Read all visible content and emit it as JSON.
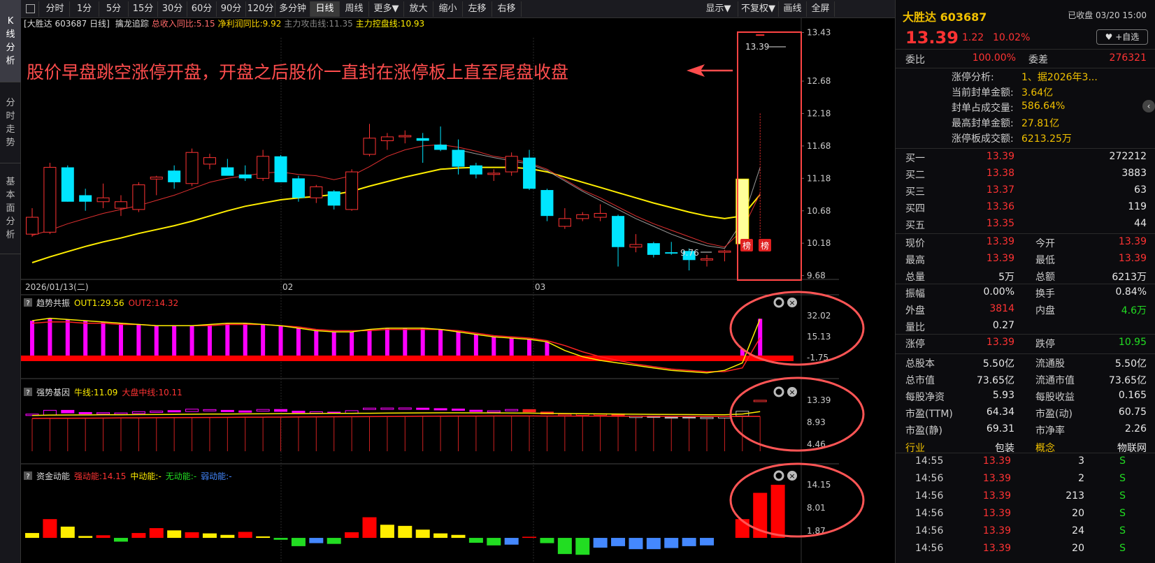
{
  "left_tabs": [
    {
      "label": "K线分析",
      "active": true
    },
    {
      "label": "分时走势",
      "active": false
    },
    {
      "label": "基本面分析",
      "active": false
    }
  ],
  "toolbar": {
    "left": [
      "分时",
      "1分",
      "5分",
      "15分",
      "30分",
      "60分",
      "90分",
      "120分",
      "多分钟",
      "日线",
      "周线",
      "更多▼",
      "放大",
      "缩小",
      "左移",
      "右移"
    ],
    "active": "日线",
    "right": [
      "显示▼",
      "不复权▼",
      "画线",
      "全屏"
    ]
  },
  "main_panel": {
    "stock_label": "[大胜达 603687 日线]",
    "indicator_name": "擒龙追踪",
    "items": [
      {
        "text": "总收入同比:5.15",
        "color": "#ff6a6a"
      },
      {
        "text": "净利润同比:9.92",
        "color": "#ffd700"
      },
      {
        "text": "主力攻击线:11.35",
        "color": "#888888"
      },
      {
        "text": "主力控盘线:10.93",
        "color": "#ffee00"
      }
    ],
    "yticks": [
      "13.43",
      "12.68",
      "12.18",
      "11.68",
      "11.18",
      "10.68",
      "10.18",
      "9.68"
    ],
    "date_labels": [
      "2026/01/13(二)",
      "02",
      "03"
    ],
    "annotation": "股价早盘跳空涨停开盘，开盘之后股价一直封在涨停板上直至尾盘收盘",
    "price_high_label": "13.39",
    "price_low_label": "9.76",
    "badge": "榜"
  },
  "sub1": {
    "title": "趋势共振",
    "items": [
      {
        "text": "OUT1:29.56",
        "color": "#ffee00"
      },
      {
        "text": "OUT2:14.32",
        "color": "#ff3333"
      }
    ],
    "yticks": [
      "32.02",
      "15.13",
      "-1.75"
    ]
  },
  "sub2": {
    "title": "强势基因",
    "items": [
      {
        "text": "牛线:11.09",
        "color": "#ffee00"
      },
      {
        "text": "大盘中线:10.11",
        "color": "#ff3333"
      }
    ],
    "yticks": [
      "13.39",
      "8.93",
      "4.46"
    ]
  },
  "sub3": {
    "title": "资金动能",
    "items": [
      {
        "text": "强动能:14.15",
        "color": "#ff3333"
      },
      {
        "text": "中动能:-",
        "color": "#ffee00"
      },
      {
        "text": "无动能:-",
        "color": "#22dd22"
      },
      {
        "text": "弱动能:-",
        "color": "#4488ff"
      }
    ],
    "yticks": [
      "14.15",
      "8.01",
      "1.87"
    ]
  },
  "right_panel": {
    "title": "大胜达 603687",
    "status": "已收盘 03/20 15:00",
    "price": "13.39",
    "change": "1.22",
    "change_pct": "10.02%",
    "fav": "♥ +自选",
    "webi_label": "委比",
    "webi": "100.00%",
    "weicha_label": "委差",
    "weicha": "276321",
    "limit_analysis": [
      {
        "label": "涨停分析:",
        "value": "1、据2026年3..."
      },
      {
        "label": "当前封单金额:",
        "value": "3.64亿"
      },
      {
        "label": "封单占成交量:",
        "value": "586.64%"
      },
      {
        "label": "最高封单金额:",
        "value": "27.81亿"
      },
      {
        "label": "涨停板成交额:",
        "value": "6213.25万"
      }
    ],
    "bids": [
      {
        "label": "买一",
        "price": "13.39",
        "vol": "272212"
      },
      {
        "label": "买二",
        "price": "13.38",
        "vol": "3883"
      },
      {
        "label": "买三",
        "price": "13.37",
        "vol": "63"
      },
      {
        "label": "买四",
        "price": "13.36",
        "vol": "119"
      },
      {
        "label": "买五",
        "price": "13.35",
        "vol": "44"
      }
    ],
    "quote_rows": [
      {
        "l1": "现价",
        "v1": "13.39",
        "c1": "red",
        "l2": "今开",
        "v2": "13.39",
        "c2": "red"
      },
      {
        "l1": "最高",
        "v1": "13.39",
        "c1": "red",
        "l2": "最低",
        "v2": "13.39",
        "c2": "red"
      },
      {
        "l1": "总量",
        "v1": "5万",
        "c1": "white",
        "l2": "总额",
        "v2": "6213万",
        "c2": "white"
      }
    ],
    "stat_rows": [
      {
        "l1": "振幅",
        "v1": "0.00%",
        "c1": "white",
        "l2": "换手",
        "v2": "0.84%",
        "c2": "white"
      },
      {
        "l1": "外盘",
        "v1": "3814",
        "c1": "red",
        "l2": "内盘",
        "v2": "4.6万",
        "c2": "green"
      },
      {
        "l1": "量比",
        "v1": "0.27",
        "c1": "white",
        "l2": "",
        "v2": "",
        "c2": "white"
      }
    ],
    "limit_rows": [
      {
        "l1": "涨停",
        "v1": "13.39",
        "c1": "red",
        "l2": "跌停",
        "v2": "10.95",
        "c2": "green"
      }
    ],
    "fin_rows": [
      {
        "l1": "总股本",
        "v1": "5.50亿",
        "c1": "white",
        "l2": "流通股",
        "v2": "5.50亿",
        "c2": "white"
      },
      {
        "l1": "总市值",
        "v1": "73.65亿",
        "c1": "white",
        "l2": "流通市值",
        "v2": "73.65亿",
        "c2": "white"
      },
      {
        "l1": "每股净资",
        "v1": "5.93",
        "c1": "white",
        "l2": "每股收益",
        "v2": "0.165",
        "c2": "white"
      },
      {
        "l1": "市盈(TTM)",
        "v1": "64.34",
        "c1": "white",
        "l2": "市盈(动)",
        "v2": "60.75",
        "c2": "white"
      },
      {
        "l1": "市盈(静)",
        "v1": "69.31",
        "c1": "white",
        "l2": "市净率",
        "v2": "2.26",
        "c2": "white"
      }
    ],
    "industry": {
      "label": "行业",
      "value": "包装",
      "label2": "概念",
      "value2": "物联网"
    },
    "ticks": [
      {
        "time": "14:55",
        "price": "13.39",
        "vol": "3",
        "bs": "S"
      },
      {
        "time": "14:56",
        "price": "13.39",
        "vol": "2",
        "bs": "S"
      },
      {
        "time": "14:56",
        "price": "13.39",
        "vol": "213",
        "bs": "S"
      },
      {
        "time": "14:56",
        "price": "13.39",
        "vol": "20",
        "bs": "S"
      },
      {
        "time": "14:56",
        "price": "13.39",
        "vol": "24",
        "bs": "S"
      },
      {
        "time": "14:56",
        "price": "13.39",
        "vol": "20",
        "bs": "S"
      }
    ]
  },
  "chart_data": {
    "type": "candlestick",
    "candles": [
      {
        "o": 10.32,
        "h": 10.72,
        "l": 10.28,
        "c": 10.58
      },
      {
        "o": 10.35,
        "h": 11.42,
        "l": 10.32,
        "c": 11.35
      },
      {
        "o": 11.35,
        "h": 11.38,
        "l": 10.82,
        "c": 10.82
      },
      {
        "o": 10.92,
        "h": 11.02,
        "l": 10.68,
        "c": 10.82
      },
      {
        "o": 10.82,
        "h": 11.1,
        "l": 10.72,
        "c": 10.88
      },
      {
        "o": 10.72,
        "h": 10.92,
        "l": 10.6,
        "c": 10.82
      },
      {
        "o": 10.7,
        "h": 11.12,
        "l": 10.66,
        "c": 11.08
      },
      {
        "o": 11.17,
        "h": 11.22,
        "l": 10.92,
        "c": 11.2
      },
      {
        "o": 11.3,
        "h": 11.38,
        "l": 11.02,
        "c": 11.12
      },
      {
        "o": 11.1,
        "h": 11.64,
        "l": 11.06,
        "c": 11.58
      },
      {
        "o": 11.4,
        "h": 11.56,
        "l": 11.32,
        "c": 11.5
      },
      {
        "o": 11.35,
        "h": 11.48,
        "l": 11.24,
        "c": 11.22
      },
      {
        "o": 11.24,
        "h": 11.38,
        "l": 11.14,
        "c": 11.18
      },
      {
        "o": 11.18,
        "h": 11.62,
        "l": 11.14,
        "c": 11.52
      },
      {
        "o": 11.52,
        "h": 11.54,
        "l": 11.12,
        "c": 11.12
      },
      {
        "o": 11.18,
        "h": 11.22,
        "l": 10.82,
        "c": 10.88
      },
      {
        "o": 10.88,
        "h": 11.08,
        "l": 10.8,
        "c": 11.05
      },
      {
        "o": 10.98,
        "h": 11.0,
        "l": 10.7,
        "c": 10.76
      },
      {
        "o": 10.7,
        "h": 11.32,
        "l": 10.68,
        "c": 11.28
      },
      {
        "o": 11.55,
        "h": 12.02,
        "l": 11.52,
        "c": 11.8
      },
      {
        "o": 11.76,
        "h": 11.88,
        "l": 11.62,
        "c": 11.82
      },
      {
        "o": 11.82,
        "h": 11.92,
        "l": 11.72,
        "c": 11.84
      },
      {
        "o": 11.8,
        "h": 11.88,
        "l": 11.42,
        "c": 11.76
      },
      {
        "o": 11.7,
        "h": 11.98,
        "l": 11.6,
        "c": 11.62
      },
      {
        "o": 11.62,
        "h": 11.78,
        "l": 11.24,
        "c": 11.36
      },
      {
        "o": 11.38,
        "h": 11.42,
        "l": 11.18,
        "c": 11.24
      },
      {
        "o": 11.24,
        "h": 11.32,
        "l": 11.14,
        "c": 11.26
      },
      {
        "o": 11.28,
        "h": 11.58,
        "l": 11.22,
        "c": 11.52
      },
      {
        "o": 11.5,
        "h": 11.62,
        "l": 11.0,
        "c": 11.02
      },
      {
        "o": 11.0,
        "h": 11.02,
        "l": 10.52,
        "c": 10.6
      },
      {
        "o": 10.44,
        "h": 10.72,
        "l": 10.4,
        "c": 10.56
      },
      {
        "o": 10.56,
        "h": 10.66,
        "l": 10.52,
        "c": 10.62
      },
      {
        "o": 10.58,
        "h": 10.78,
        "l": 10.52,
        "c": 10.64
      },
      {
        "o": 10.6,
        "h": 10.62,
        "l": 9.82,
        "c": 10.12
      },
      {
        "o": 10.12,
        "h": 10.32,
        "l": 10.04,
        "c": 10.16
      },
      {
        "o": 10.18,
        "h": 10.2,
        "l": 9.96,
        "c": 10.0
      },
      {
        "o": 10.04,
        "h": 10.2,
        "l": 10.0,
        "c": 10.02
      },
      {
        "o": 10.06,
        "h": 10.1,
        "l": 9.76,
        "c": 9.92
      },
      {
        "o": 9.92,
        "h": 10.0,
        "l": 9.82,
        "c": 9.94
      },
      {
        "o": 10.04,
        "h": 10.08,
        "l": 9.9,
        "c": 10.06
      },
      {
        "o": 10.17,
        "h": 11.17,
        "l": 10.17,
        "c": 11.17
      },
      {
        "o": 13.39,
        "h": 13.39,
        "l": 13.39,
        "c": 13.39
      }
    ],
    "ma_red": [
      10.3,
      10.38,
      10.48,
      10.56,
      10.64,
      10.7,
      10.76,
      10.84,
      10.92,
      11.02,
      11.12,
      11.18,
      11.22,
      11.26,
      11.28,
      11.24,
      11.22,
      11.16,
      11.22,
      11.36,
      11.52,
      11.62,
      11.68,
      11.7,
      11.66,
      11.6,
      11.52,
      11.48,
      11.42,
      11.32,
      11.16,
      11.0,
      10.88,
      10.74,
      10.6,
      10.48,
      10.38,
      10.28,
      10.18,
      10.12,
      10.38,
      10.95
    ],
    "ma_grey": [
      null,
      null,
      null,
      null,
      null,
      null,
      null,
      null,
      null,
      null,
      null,
      null,
      null,
      null,
      null,
      null,
      null,
      null,
      null,
      null,
      null,
      null,
      null,
      null,
      11.62,
      11.56,
      11.5,
      11.45,
      11.4,
      11.3,
      11.14,
      10.98,
      10.84,
      10.7,
      10.56,
      10.44,
      10.32,
      10.22,
      10.14,
      10.1,
      10.52,
      11.35
    ],
    "ma_yellow": [
      9.88,
      9.97,
      10.05,
      10.13,
      10.2,
      10.26,
      10.33,
      10.39,
      10.45,
      10.52,
      10.6,
      10.68,
      10.75,
      10.8,
      10.85,
      10.88,
      10.9,
      10.93,
      10.98,
      11.06,
      11.13,
      11.2,
      11.26,
      11.32,
      11.34,
      11.35,
      11.35,
      11.35,
      11.33,
      11.28,
      11.2,
      11.12,
      11.04,
      10.96,
      10.88,
      10.8,
      10.73,
      10.66,
      10.6,
      10.56,
      10.6,
      10.93
    ],
    "sub1_out1": [
      28,
      30,
      29,
      28,
      27,
      26,
      25,
      24,
      24,
      24,
      25,
      26,
      26,
      25,
      24,
      22,
      20,
      19,
      19,
      21,
      22,
      22,
      22,
      21,
      19,
      17,
      15,
      14,
      13,
      11,
      4,
      -1,
      -4,
      -6,
      -8,
      -10,
      -12,
      -13,
      -14,
      -12,
      -6,
      29.56
    ],
    "sub1_out2": [
      26,
      27,
      27,
      26,
      26,
      25,
      25,
      24,
      24,
      24,
      24,
      25,
      25,
      25,
      24,
      23,
      21,
      20,
      20,
      20,
      21,
      21,
      21,
      21,
      20,
      18,
      16,
      15,
      14,
      12,
      8,
      3,
      -1,
      -4,
      -7,
      -9,
      -11,
      -12,
      -13,
      -13,
      -10,
      14.32
    ],
    "sub1_bars": [
      28,
      30,
      29,
      28,
      27,
      26,
      25,
      24,
      24,
      24,
      25,
      26,
      26,
      25,
      24,
      22,
      20,
      19,
      19,
      21,
      22,
      22,
      22,
      21,
      19,
      17,
      15,
      14,
      13,
      11,
      0,
      0,
      0,
      0,
      0,
      0,
      0,
      0,
      0,
      0,
      5,
      29.56
    ],
    "sub2_bull": [
      10.3,
      10.38,
      10.4,
      10.42,
      10.44,
      10.46,
      10.48,
      10.5,
      10.52,
      10.55,
      10.58,
      10.6,
      10.62,
      10.64,
      10.66,
      10.68,
      10.7,
      10.72,
      10.74,
      10.76,
      10.78,
      10.8,
      10.82,
      10.84,
      10.84,
      10.83,
      10.82,
      10.8,
      10.78,
      10.74,
      10.7,
      10.66,
      10.62,
      10.58,
      10.55,
      10.52,
      10.5,
      10.48,
      10.46,
      10.46,
      10.6,
      11.09
    ],
    "sub2_mid": [
      9.7,
      9.72,
      9.74,
      9.76,
      9.78,
      9.8,
      9.82,
      9.84,
      9.86,
      9.88,
      9.9,
      9.92,
      9.94,
      9.96,
      9.98,
      10.0,
      10.02,
      10.04,
      10.06,
      10.08,
      10.1,
      10.12,
      10.14,
      10.16,
      10.18,
      10.19,
      10.2,
      10.2,
      10.2,
      10.19,
      10.18,
      10.17,
      10.16,
      10.15,
      10.14,
      10.13,
      10.12,
      10.11,
      10.1,
      10.1,
      10.1,
      10.11
    ],
    "sub3_bars": [
      {
        "v": 1.3,
        "c": "#ffee00"
      },
      {
        "v": 5.0,
        "c": "#ff0000"
      },
      {
        "v": 3.0,
        "c": "#ffee00"
      },
      {
        "v": 0.5,
        "c": "#ffee00"
      },
      {
        "v": 0.7,
        "c": "#ff0000"
      },
      {
        "v": -1.0,
        "c": "#22dd22"
      },
      {
        "v": 1.3,
        "c": "#ff0000"
      },
      {
        "v": 2.6,
        "c": "#ff0000"
      },
      {
        "v": 2.0,
        "c": "#ffee00"
      },
      {
        "v": 1.5,
        "c": "#ff0000"
      },
      {
        "v": 1.2,
        "c": "#ffee00"
      },
      {
        "v": 0.8,
        "c": "#ffee00"
      },
      {
        "v": 1.6,
        "c": "#ff0000"
      },
      {
        "v": 0.4,
        "c": "#ffee00"
      },
      {
        "v": -0.5,
        "c": "#22dd22"
      },
      {
        "v": -2.2,
        "c": "#22dd22"
      },
      {
        "v": -1.4,
        "c": "#4488ff"
      },
      {
        "v": -1.6,
        "c": "#22dd22"
      },
      {
        "v": 1.5,
        "c": "#ff0000"
      },
      {
        "v": 5.5,
        "c": "#ff0000"
      },
      {
        "v": 3.5,
        "c": "#ffee00"
      },
      {
        "v": 3.2,
        "c": "#ffee00"
      },
      {
        "v": 2.2,
        "c": "#ffee00"
      },
      {
        "v": 1.2,
        "c": "#ffee00"
      },
      {
        "v": 0.8,
        "c": "#ffee00"
      },
      {
        "v": -1.3,
        "c": "#22dd22"
      },
      {
        "v": -2.0,
        "c": "#22dd22"
      },
      {
        "v": -1.8,
        "c": "#4488ff"
      },
      {
        "v": 0.3,
        "c": "#ff0000"
      },
      {
        "v": -1.4,
        "c": "#22dd22"
      },
      {
        "v": -4.3,
        "c": "#22dd22"
      },
      {
        "v": -4.5,
        "c": "#22dd22"
      },
      {
        "v": -2.6,
        "c": "#4488ff"
      },
      {
        "v": -2.2,
        "c": "#4488ff"
      },
      {
        "v": -3.0,
        "c": "#4488ff"
      },
      {
        "v": -3.0,
        "c": "#4488ff"
      },
      {
        "v": -2.7,
        "c": "#4488ff"
      },
      {
        "v": -2.2,
        "c": "#4488ff"
      },
      {
        "v": -2.0,
        "c": "#4488ff"
      },
      {
        "v": 0,
        "c": "#000000"
      },
      {
        "v": 5.0,
        "c": "#ff0000"
      },
      {
        "v": 12.0,
        "c": "#ff0000"
      },
      {
        "v": 14.15,
        "c": "#ff0000"
      }
    ]
  }
}
